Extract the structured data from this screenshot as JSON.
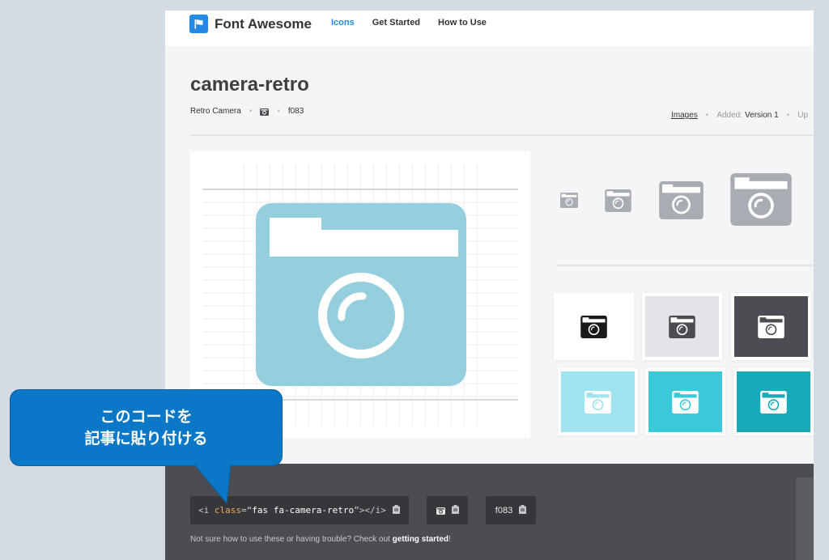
{
  "header": {
    "brand": "Font Awesome",
    "nav": [
      "Icons",
      "Get Started",
      "How to Use"
    ]
  },
  "icon": {
    "name": "camera-retro",
    "label": "Retro Camera",
    "unicode": "f083"
  },
  "meta": {
    "images_link": "Images",
    "added_label": "Added:",
    "added_value": "Version 1",
    "updated_label": "Up"
  },
  "code": {
    "open": "<i ",
    "attr": "class",
    "eq": "=",
    "q1": "“",
    "value": "fas fa-camera-retro",
    "q2": "”",
    "close": "></i>",
    "unicode": "f083"
  },
  "help": {
    "text": "Not sure how to use these or having trouble? Check out ",
    "link": "getting started",
    "end": "!"
  },
  "callout": {
    "line1": "このコードを",
    "line2": "記事に貼り付ける"
  },
  "colors": {
    "accent": "#228ae6",
    "preview_icon": "#95cfdd",
    "size_icon": "#a8adb3",
    "dark_bar": "#4b4d52",
    "callout": "#0a78c6"
  },
  "icons": {
    "brand": "flag-icon",
    "main": "camera-retro-icon",
    "copy": "clipboard-icon"
  }
}
